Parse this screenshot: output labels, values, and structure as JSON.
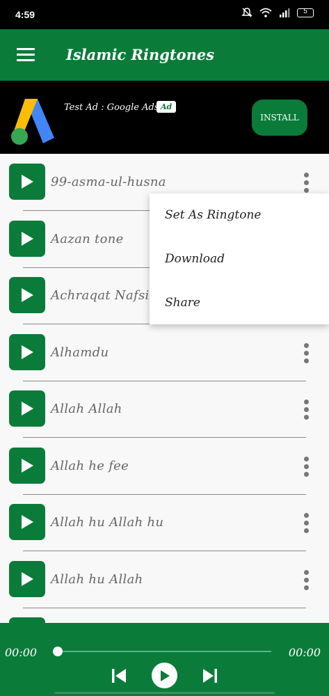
{
  "status_bar": {
    "time": "4:59",
    "battery": "5",
    "icons": [
      "mute-icon",
      "wifi-icon",
      "signal-icon",
      "battery-icon"
    ]
  },
  "app_bar": {
    "title": "Islamic Ringtones",
    "menu_icon": "hamburger-menu-icon"
  },
  "ad": {
    "text": "Test Ad : Google Ads",
    "badge": "Ad",
    "install_label": "INSTALL",
    "logo": "google-ads-logo"
  },
  "ringtones": [
    {
      "title": "99-asma-ul-husna"
    },
    {
      "title": "Aazan tone"
    },
    {
      "title": "Achraqat Nafsi"
    },
    {
      "title": "Alhamdu"
    },
    {
      "title": "Allah Allah"
    },
    {
      "title": "Allah he fee"
    },
    {
      "title": "Allah hu Allah hu"
    },
    {
      "title": "Allah hu Allah"
    }
  ],
  "context_menu": {
    "set_ringtone": "Set As Ringtone",
    "download": "Download",
    "share": "Share"
  },
  "player": {
    "current_time": "00:00",
    "total_time": "00:00",
    "progress": 0
  },
  "colors": {
    "primary": "#0b7b3a",
    "background": "#f8f8f8"
  }
}
